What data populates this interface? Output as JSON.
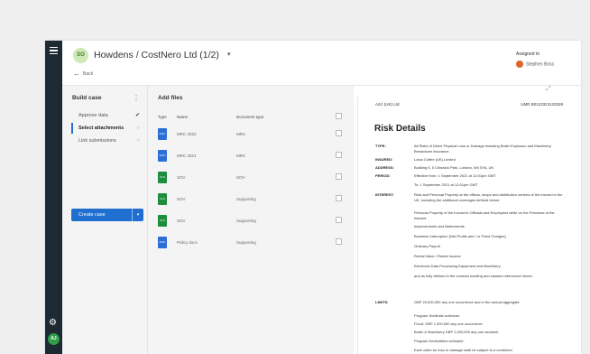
{
  "header": {
    "case_badge": "SO",
    "title": "Howdens / CostNero Ltd (1/2)",
    "back_label": "Back",
    "assigned_label": "Assigned to",
    "assignee": "Stephen Boss"
  },
  "rail": {
    "user_initials": "AJ"
  },
  "build": {
    "title": "Build case",
    "steps": [
      {
        "label": "Approve data",
        "mark": "✔"
      },
      {
        "label": "Select attachments",
        "mark": "○"
      },
      {
        "label": "Link submissions",
        "mark": "○"
      }
    ],
    "create_button": "Create case"
  },
  "files": {
    "title": "Add files",
    "columns": {
      "type": "Type",
      "name": "Name",
      "doc_type": "Document type"
    },
    "rows": [
      {
        "name": "MRC 2022",
        "doc_type": "MRC",
        "icon": "word-doc-icon",
        "icon_color": "#2b6fd6",
        "ext": "DOC"
      },
      {
        "name": "MRC 2021",
        "doc_type": "MRC",
        "icon": "word-doc-icon",
        "icon_color": "#2b6fd6",
        "ext": "DOC"
      },
      {
        "name": "SOV",
        "doc_type": "SOV",
        "icon": "excel-sheet-icon",
        "icon_color": "#1e8e3e",
        "ext": "XLS"
      },
      {
        "name": "SOV",
        "doc_type": "Supporting",
        "icon": "excel-sheet-icon",
        "icon_color": "#1e8e3e",
        "ext": "XLS"
      },
      {
        "name": "SOV",
        "doc_type": "Supporting",
        "icon": "excel-sheet-icon",
        "icon_color": "#1e8e3e",
        "ext": "XLS"
      },
      {
        "name": "Policy docs",
        "doc_type": "Supporting",
        "icon": "word-doc-icon",
        "icon_color": "#2b6fd6",
        "ext": "DOC"
      }
    ]
  },
  "document": {
    "insurer": "Aziz (UK) Ltd",
    "umr": "UMR B0123321123328",
    "heading": "Risk Details",
    "lines": [
      {
        "label": "TYPE:",
        "value": "All Risks of Direct Physical Loss or Damage including Boiler Explosion and Machinery Breakdown insurance."
      },
      {
        "label": "INSURED:",
        "value": "Lotus Coffee (UK) Limited"
      },
      {
        "label": "ADDRESS:",
        "value": "Building 5, 5 Chiswick Park, London, W4 5YA, UK"
      },
      {
        "label": "PERIOD:",
        "value": "Effective from:    1 September 2021 at 12:01pm GMT"
      },
      {
        "label": "",
        "value": "To:                     1 September 2021 at 12:01pm GMT"
      },
      {
        "label": "INTEREST:",
        "value": "Real and Personal Property at the offices, shops and distribution centres of the insured in the UK, including the additional coverages defined below:"
      },
      {
        "label": "",
        "value": "Personal Property of the Insured's Officials and Employees while on the Premises of the Insured"
      },
      {
        "label": "",
        "value": "Improvements and Betterments"
      },
      {
        "label": "",
        "value": "Business Interruption (Net Profits and / or Fixed Charges)"
      },
      {
        "label": "",
        "value": "Ordinary Payroll"
      },
      {
        "label": "",
        "value": "Rental Value / Rental Income"
      },
      {
        "label": "",
        "value": "Electronic Data Processing Equipment and Machinery"
      },
      {
        "label": "",
        "value": "and as fully defined in the contract wording and clauses referenced herein."
      },
      {
        "label": "LIMITS:",
        "value": "GBP 20,000,000   any one occurrence and in the annual aggregate"
      },
      {
        "label": "",
        "value": "Program Sublimits schedule:"
      },
      {
        "label": "",
        "value": "Flood:                   GBP 1,000,000 any one occurrence"
      },
      {
        "label": "",
        "value": "Boiler & Machinery   GBP 1,000,000 any one accident"
      },
      {
        "label": "",
        "value": "Program Deductibles schedule:"
      },
      {
        "label": "",
        "value": "Each claim for loss or damage shall be subject to a combined"
      }
    ]
  }
}
